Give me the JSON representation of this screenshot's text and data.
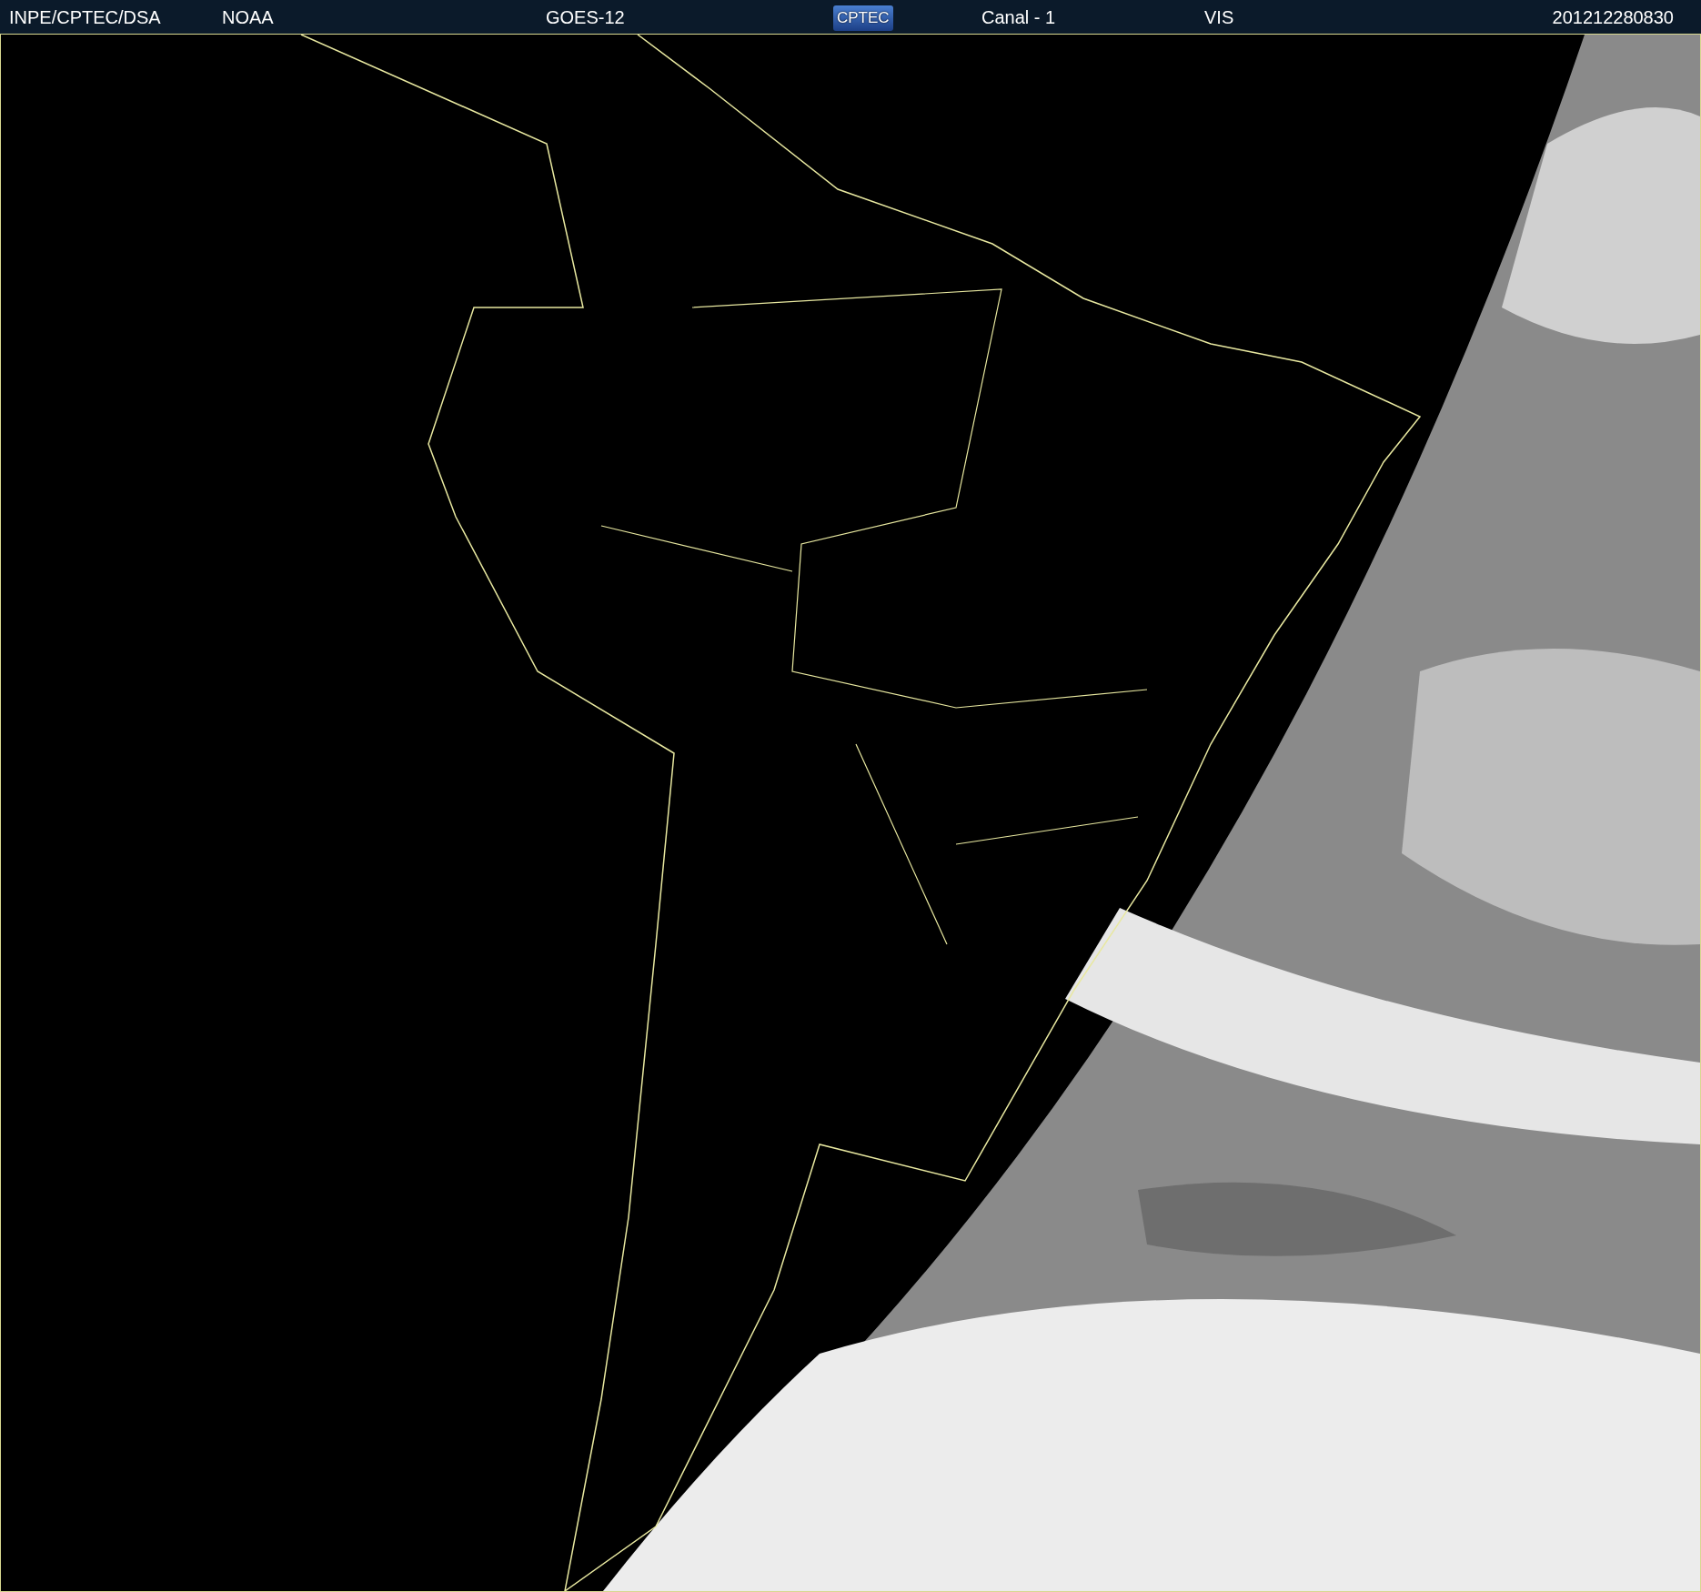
{
  "header": {
    "items": [
      {
        "kind": "text",
        "text": "INPE/CPTEC/DSA"
      },
      {
        "kind": "text",
        "text": "NOAA"
      },
      {
        "kind": "text",
        "text": "GOES-12"
      },
      {
        "kind": "logo",
        "text": "CPTEC"
      },
      {
        "kind": "text",
        "text": "Canal - 1"
      },
      {
        "kind": "text",
        "text": "VIS"
      },
      {
        "kind": "text",
        "text": "201212280830"
      }
    ]
  }
}
